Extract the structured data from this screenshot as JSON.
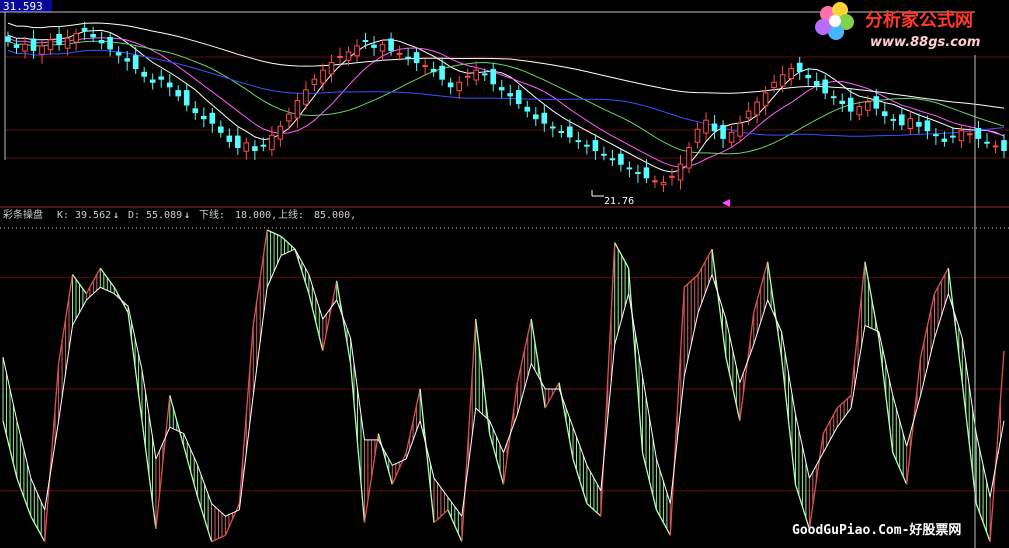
{
  "price_badge": "31.593",
  "logo": {
    "title": "分析家公式网",
    "url": "www.88gs.com"
  },
  "indicator": {
    "name": "彩条操盘",
    "k_label": "K:",
    "k_value": "39.562",
    "d_label": "D:",
    "d_value": "55.089",
    "lower_label": "下线:",
    "lower_value": "18.000,",
    "upper_label": "上线:",
    "upper_value": "85.000,",
    "arrow": "↓"
  },
  "low_marker": "21.76",
  "watermark": "GoodGuPiao.Com-好股票网",
  "colors": {
    "up_candle": "#ff4a4a",
    "down_candle": "#54fcfc",
    "ma_white": "#ffffff",
    "ma_magenta": "#ff5cff",
    "ma_green": "#6ad36a",
    "ma_blue": "#3a52ff",
    "k_rise": "#c86464",
    "k_fall": "#90ee90",
    "guide": "#5a0f0f",
    "divider": "#8b2b2b"
  },
  "chart_data": [
    {
      "type": "candlestick",
      "title": "",
      "series": [
        {
          "name": "close",
          "values": [
            31.2,
            30.8,
            31.0,
            30.6,
            30.9,
            31.3,
            31.0,
            31.4,
            31.7,
            31.9,
            31.5,
            31.1,
            30.7,
            30.3,
            29.9,
            29.4,
            28.9,
            28.5,
            28.7,
            28.2,
            27.6,
            27.0,
            26.5,
            26.1,
            25.8,
            25.2,
            24.6,
            24.2,
            24.5,
            24.0,
            24.3,
            25.0,
            25.6,
            26.4,
            27.3,
            28.0,
            28.7,
            29.3,
            29.8,
            30.2,
            30.5,
            30.9,
            31.2,
            30.8,
            31.0,
            30.6,
            30.4,
            30.1,
            29.8,
            29.6,
            29.2,
            28.7,
            28.2,
            28.5,
            28.9,
            29.3,
            29.0,
            28.4,
            28.0,
            27.6,
            27.1,
            26.6,
            26.1,
            25.8,
            25.5,
            25.2,
            24.9,
            24.6,
            24.3,
            24.0,
            23.7,
            23.4,
            23.1,
            22.8,
            22.5,
            22.2,
            22.0,
            21.9,
            22.3,
            23.1,
            24.2,
            25.4,
            26.0,
            25.3,
            24.8,
            25.2,
            25.8,
            26.6,
            27.2,
            27.8,
            28.5,
            29.0,
            29.4,
            29.2,
            28.8,
            28.3,
            27.8,
            27.5,
            27.1,
            26.6,
            26.9,
            27.2,
            26.8,
            26.3,
            26.0,
            25.7,
            26.1,
            25.6,
            25.3,
            25.0,
            24.6,
            24.9,
            25.3,
            25.1,
            24.8,
            24.5,
            24.3,
            24.0
          ]
        }
      ],
      "moving_averages": [
        "white",
        "magenta",
        "green",
        "blue"
      ],
      "annotations": [
        "31.593",
        "21.76"
      ],
      "grid": true
    },
    {
      "type": "line",
      "title": "彩条操盘",
      "series": [
        {
          "name": "K",
          "values": [
            40,
            22,
            10,
            2,
            58,
            86,
            80,
            88,
            82,
            74,
            40,
            6,
            48,
            32,
            16,
            2,
            4,
            14,
            70,
            100,
            98,
            94,
            80,
            62,
            84,
            58,
            8,
            36,
            20,
            30,
            50,
            8,
            12,
            2,
            72,
            36,
            20,
            52,
            72,
            44,
            52,
            28,
            14,
            10,
            96,
            88,
            30,
            12,
            4,
            82,
            86,
            94,
            60,
            40,
            74,
            90,
            60,
            20,
            6,
            36,
            44,
            48,
            90,
            66,
            30,
            20,
            60,
            80,
            88,
            52,
            14,
            2,
            62
          ]
        },
        {
          "name": "D",
          "values": [
            60,
            40,
            22,
            12,
            40,
            70,
            78,
            82,
            80,
            76,
            56,
            28,
            38,
            36,
            26,
            14,
            10,
            12,
            48,
            82,
            92,
            94,
            86,
            72,
            78,
            66,
            34,
            34,
            26,
            28,
            40,
            22,
            16,
            10,
            44,
            40,
            30,
            42,
            58,
            50,
            50,
            38,
            26,
            18,
            64,
            80,
            54,
            28,
            14,
            54,
            74,
            86,
            72,
            52,
            64,
            78,
            68,
            42,
            22,
            30,
            38,
            44,
            70,
            68,
            48,
            32,
            48,
            66,
            80,
            66,
            36,
            16,
            40
          ]
        }
      ],
      "upper": 85,
      "lower": 18,
      "latest": {
        "K": 39.562,
        "D": 55.089
      },
      "ylim": [
        0,
        100
      ],
      "grid": true
    }
  ]
}
